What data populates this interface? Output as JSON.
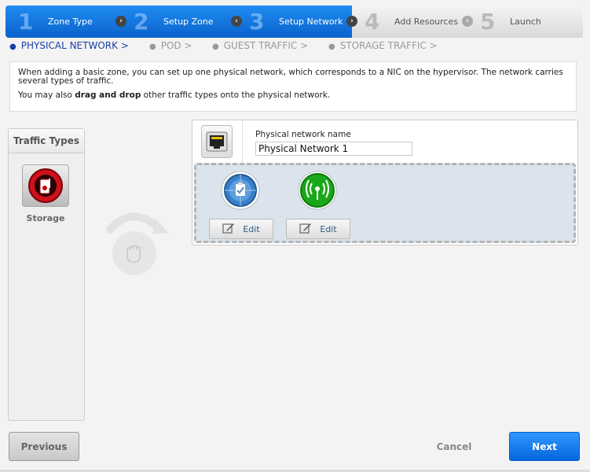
{
  "steps": [
    {
      "num": "1",
      "label": "Zone Type",
      "state": "active"
    },
    {
      "num": "2",
      "label": "Setup Zone",
      "state": "active"
    },
    {
      "num": "3",
      "label": "Setup Network",
      "state": "active"
    },
    {
      "num": "4",
      "label": "Add Resources",
      "state": "inactive"
    },
    {
      "num": "5",
      "label": "Launch",
      "state": "inactive"
    }
  ],
  "subnav": {
    "physical_network": "PHYSICAL NETWORK  >",
    "pod": "POD  >",
    "guest_traffic": "GUEST TRAFFIC  >",
    "storage_traffic": "STORAGE TRAFFIC  >"
  },
  "info": {
    "line1": "When adding a basic zone, you can set up one physical network, which corresponds to a NIC on the hypervisor. The network carries several types of traffic.",
    "line2_prefix": "You may also ",
    "line2_bold": "drag and drop",
    "line2_suffix": " other traffic types onto the physical network."
  },
  "traffic_types": {
    "title": "Traffic Types",
    "storage_label": "Storage"
  },
  "physical_network": {
    "name_label": "Physical network name",
    "name_value": "Physical Network 1",
    "traffic_slots": [
      {
        "icon": "management-traffic-icon",
        "edit_label": "Edit"
      },
      {
        "icon": "guest-traffic-icon",
        "edit_label": "Edit"
      }
    ]
  },
  "buttons": {
    "previous": "Previous",
    "cancel": "Cancel",
    "next": "Next"
  },
  "colors": {
    "active_step": "#0a63cc",
    "accent_blue": "#1a3ea8",
    "next_button": "#0666dd",
    "storage_red": "#d0101b",
    "guest_green": "#19a819"
  }
}
